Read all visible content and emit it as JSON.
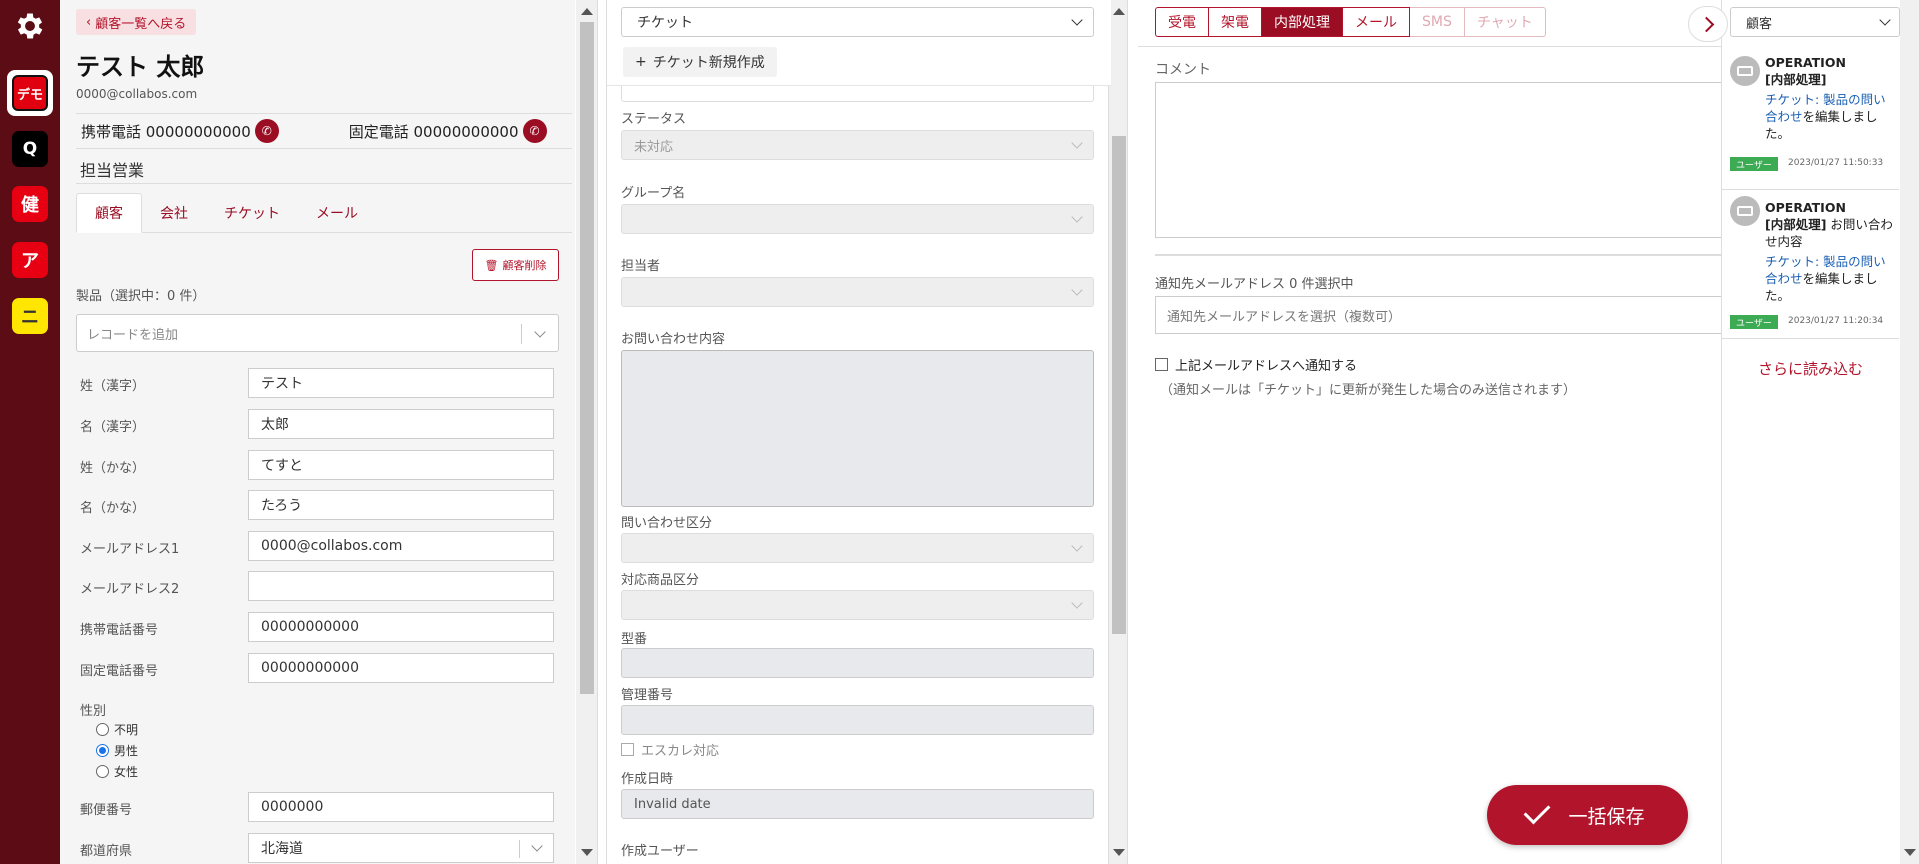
{
  "rail": {
    "demo_label": "デモ",
    "q_label": "Q",
    "ken_label": "健",
    "a_label": "ア",
    "ni_label": "ニ"
  },
  "customer": {
    "back_label": "顧客一覧へ戻る",
    "name": "テスト 太郎",
    "email": "0000@collabos.com",
    "mobile": "携帯電話 00000000000",
    "landline": "固定電話 00000000000",
    "sales": "担当営業",
    "tabs": [
      "顧客",
      "会社",
      "チケット",
      "メール"
    ],
    "delete_label": "顧客削除",
    "products_label": "製品（選択中：0 件）",
    "record_placeholder": "レコードを追加",
    "fields": [
      {
        "label": "姓（漢字）",
        "value": "テスト"
      },
      {
        "label": "名（漢字）",
        "value": "太郎"
      },
      {
        "label": "姓（かな）",
        "value": "てすと"
      },
      {
        "label": "名（かな）",
        "value": "たろう"
      },
      {
        "label": "メールアドレス1",
        "value": "0000@collabos.com"
      },
      {
        "label": "メールアドレス2",
        "value": ""
      },
      {
        "label": "携帯電話番号",
        "value": "00000000000"
      },
      {
        "label": "固定電話番号",
        "value": "00000000000"
      }
    ],
    "gender_label": "性別",
    "gender_options": [
      "不明",
      "男性",
      "女性"
    ],
    "gender_selected": "男性",
    "postal_label": "郵便番号",
    "postal_value": "0000000",
    "pref_label": "都道府県",
    "pref_value": "北海道"
  },
  "ticket": {
    "select_value": "チケット",
    "new_label": "チケット新規作成",
    "status_label": "ステータス",
    "status_value": "未対応",
    "group_label": "グループ名",
    "assignee_label": "担当者",
    "inquiry_label": "お問い合わせ内容",
    "category_label": "問い合わせ区分",
    "product_category_label": "対応商品区分",
    "model_label": "型番",
    "manage_label": "管理番号",
    "escalation_label": "エスカレ対応",
    "created_label": "作成日時",
    "created_value": "Invalid date",
    "creator_label": "作成ユーザー"
  },
  "activity": {
    "tabs": [
      {
        "label": "受電",
        "state": "normal"
      },
      {
        "label": "架電",
        "state": "normal"
      },
      {
        "label": "内部処理",
        "state": "active"
      },
      {
        "label": "メール",
        "state": "normal"
      },
      {
        "label": "SMS",
        "state": "disabled"
      },
      {
        "label": "チャット",
        "state": "disabled"
      }
    ],
    "comment_label": "コメント",
    "notify_label": "通知先メールアドレス 0 件選択中",
    "notify_placeholder": "通知先メールアドレスを選択（複数可）",
    "notify_check_label": "上記メールアドレスへ通知する",
    "notify_note": "（通知メールは「チケット」に更新が発生した場合のみ送信されます）",
    "save_all_label": "一括保存"
  },
  "history": {
    "select_value": "顧客",
    "items": [
      {
        "user": "OPERATION",
        "type": "[内部処理]",
        "suffix": "",
        "link": "チケット: 製品の問い合わせ",
        "action": "を編集しました。",
        "badge": "ユーザー",
        "time": "2023/01/27 11:50:33"
      },
      {
        "user": "OPERATION",
        "type": "[内部処理]",
        "suffix": " お問い合わせ内容",
        "link": "チケット: 製品の問い合わせ",
        "action": "を編集しました。",
        "badge": "ユーザー",
        "time": "2023/01/27 11:20:34"
      }
    ],
    "load_more_label": "さらに読み込む"
  },
  "colors": {
    "brand": "#9a0d23",
    "rail": "#5c0c14",
    "badge": "#3daa54"
  }
}
